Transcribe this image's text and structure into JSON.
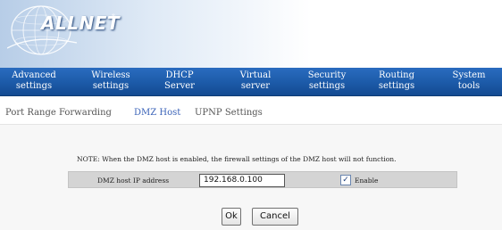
{
  "brand": {
    "name": "ALLNET",
    "registered": "®"
  },
  "nav": {
    "items": [
      {
        "line1": "Advanced",
        "line2": "settings"
      },
      {
        "line1": "Wireless",
        "line2": "settings"
      },
      {
        "line1": "DHCP",
        "line2": "Server"
      },
      {
        "line1": "Virtual",
        "line2": "server"
      },
      {
        "line1": "Security",
        "line2": "settings"
      },
      {
        "line1": "Routing",
        "line2": "settings"
      },
      {
        "line1": "System",
        "line2": "tools"
      }
    ],
    "active_index": 3
  },
  "subnav": {
    "items": [
      "Port Range Forwarding",
      "DMZ Host",
      "UPNP Settings"
    ],
    "active_index": 1
  },
  "dmz": {
    "note": "NOTE: When the DMZ host is enabled, the firewall settings of the DMZ host will not function.",
    "ip_label": "DMZ host IP address",
    "ip_value": "192.168.0.100",
    "enable_label": "Enable",
    "enable_checked": true
  },
  "buttons": {
    "ok": "Ok",
    "cancel": "Cancel"
  },
  "colors": {
    "nav_blue": "#1c5aa8",
    "active_sub": "#3b63b8",
    "panel_bg": "#f7f7f7",
    "field_row_bg": "#d4d4d4"
  }
}
